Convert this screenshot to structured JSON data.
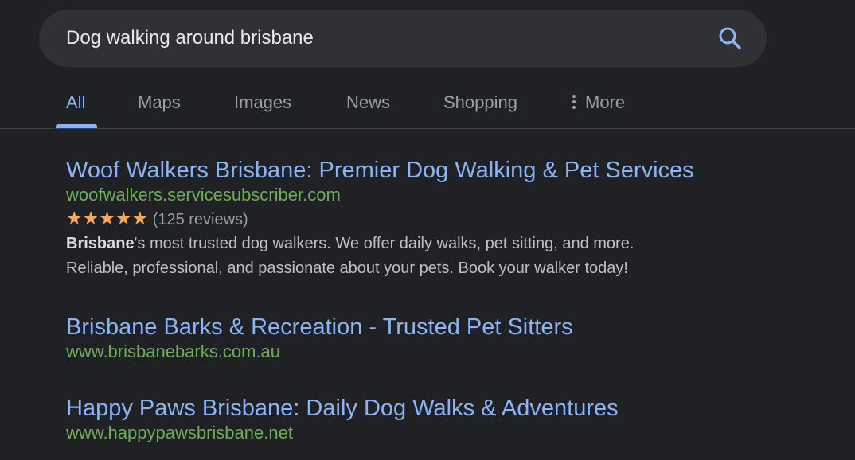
{
  "search": {
    "query": "Dog walking around brisbane"
  },
  "tabs": [
    {
      "label": "All",
      "active": true
    },
    {
      "label": "Maps"
    },
    {
      "label": "Images"
    },
    {
      "label": "News"
    },
    {
      "label": "Shopping"
    },
    {
      "label": "More"
    }
  ],
  "results": [
    {
      "title": "Woof Walkers Brisbane: Premier Dog Walking & Pet Services",
      "url": "woofwalkers.servicesubscriber.com",
      "rating": {
        "stars": "★★★★★",
        "stars_value": 5,
        "reviews": "(125 reviews)"
      },
      "snippet": {
        "bold": "Brisbane",
        "line1_rest": "'s most trusted dog walkers. We offer daily walks, pet sitting, and more.",
        "line2": "Reliable, professional, and passionate about your pets. Book your walker today!"
      }
    },
    {
      "title": "Brisbane Barks & Recreation - Trusted Pet Sitters",
      "url": "www.brisbanebarks.com.au"
    },
    {
      "title": "Happy Paws Brisbane: Daily Dog Walks & Adventures",
      "url": "www.happypawsbrisbane.net"
    }
  ],
  "colors": {
    "background": "#202124",
    "search_bar": "#303134",
    "link": "#8ab4f8",
    "url": "#6fae59",
    "stars": "#f4a95a",
    "text_muted": "#9aa0a6"
  }
}
